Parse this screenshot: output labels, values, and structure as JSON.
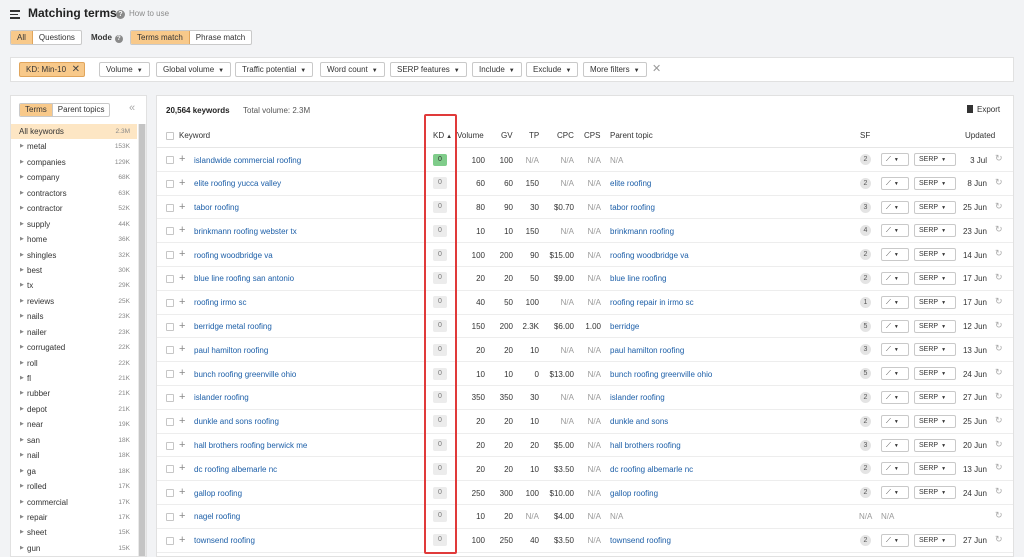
{
  "header": {
    "title": "Matching terms",
    "how_to_use": "How to use",
    "tabs": [
      "All",
      "Questions"
    ],
    "mode_label": "Mode",
    "modes": [
      "Terms match",
      "Phrase match"
    ]
  },
  "filters": {
    "active": "KD: Min-10",
    "buttons": [
      "Volume",
      "Global volume",
      "Traffic potential",
      "Word count",
      "SERP features",
      "Include",
      "Exclude",
      "More filters"
    ]
  },
  "sidebar": {
    "tabs": [
      "Terms",
      "Parent topics"
    ],
    "items": [
      {
        "label": "All keywords",
        "count": "2.3M"
      },
      {
        "label": "metal",
        "count": "153K"
      },
      {
        "label": "companies",
        "count": "129K"
      },
      {
        "label": "company",
        "count": "68K"
      },
      {
        "label": "contractors",
        "count": "63K"
      },
      {
        "label": "contractor",
        "count": "52K"
      },
      {
        "label": "supply",
        "count": "44K"
      },
      {
        "label": "home",
        "count": "36K"
      },
      {
        "label": "shingles",
        "count": "32K"
      },
      {
        "label": "best",
        "count": "30K"
      },
      {
        "label": "tx",
        "count": "29K"
      },
      {
        "label": "reviews",
        "count": "25K"
      },
      {
        "label": "nails",
        "count": "23K"
      },
      {
        "label": "nailer",
        "count": "23K"
      },
      {
        "label": "corrugated",
        "count": "22K"
      },
      {
        "label": "roll",
        "count": "22K"
      },
      {
        "label": "fl",
        "count": "21K"
      },
      {
        "label": "rubber",
        "count": "21K"
      },
      {
        "label": "depot",
        "count": "21K"
      },
      {
        "label": "near",
        "count": "19K"
      },
      {
        "label": "san",
        "count": "18K"
      },
      {
        "label": "nail",
        "count": "18K"
      },
      {
        "label": "ga",
        "count": "18K"
      },
      {
        "label": "rolled",
        "count": "17K"
      },
      {
        "label": "commercial",
        "count": "17K"
      },
      {
        "label": "repair",
        "count": "17K"
      },
      {
        "label": "sheet",
        "count": "15K"
      },
      {
        "label": "gun",
        "count": "15K"
      }
    ]
  },
  "main": {
    "keyword_count": "20,564 keywords",
    "total_volume": "Total volume: 2.3M",
    "export_label": "Export",
    "columns": {
      "keyword": "Keyword",
      "kd": "KD",
      "volume": "Volume",
      "gv": "GV",
      "tp": "TP",
      "cpc": "CPC",
      "cps": "CPS",
      "parent": "Parent topic",
      "sf": "SF",
      "updated": "Updated"
    },
    "serp_label": "SERP",
    "rows": [
      {
        "keyword": "islandwide commercial roofing",
        "kd": "0",
        "volume": "100",
        "gv": "100",
        "tp": "N/A",
        "cpc": "N/A",
        "cps": "N/A",
        "parent": "N/A",
        "sf": "2",
        "updated": "3 Jul"
      },
      {
        "keyword": "elite roofing yucca valley",
        "kd": "0",
        "volume": "60",
        "gv": "60",
        "tp": "150",
        "cpc": "N/A",
        "cps": "N/A",
        "parent": "elite roofing",
        "sf": "2",
        "updated": "8 Jun"
      },
      {
        "keyword": "tabor roofing",
        "kd": "0",
        "volume": "80",
        "gv": "90",
        "tp": "30",
        "cpc": "$0.70",
        "cps": "N/A",
        "parent": "tabor roofing",
        "sf": "3",
        "updated": "25 Jun"
      },
      {
        "keyword": "brinkmann roofing webster tx",
        "kd": "0",
        "volume": "10",
        "gv": "10",
        "tp": "150",
        "cpc": "N/A",
        "cps": "N/A",
        "parent": "brinkmann roofing",
        "sf": "4",
        "updated": "23 Jun"
      },
      {
        "keyword": "roofing woodbridge va",
        "kd": "0",
        "volume": "100",
        "gv": "200",
        "tp": "90",
        "cpc": "$15.00",
        "cps": "N/A",
        "parent": "roofing woodbridge va",
        "sf": "2",
        "updated": "14 Jun"
      },
      {
        "keyword": "blue line roofing san antonio",
        "kd": "0",
        "volume": "20",
        "gv": "20",
        "tp": "50",
        "cpc": "$9.00",
        "cps": "N/A",
        "parent": "blue line roofing",
        "sf": "2",
        "updated": "17 Jun"
      },
      {
        "keyword": "roofing irmo sc",
        "kd": "0",
        "volume": "40",
        "gv": "50",
        "tp": "100",
        "cpc": "N/A",
        "cps": "N/A",
        "parent": "roofing repair in irmo sc",
        "sf": "1",
        "updated": "17 Jun"
      },
      {
        "keyword": "berridge metal roofing",
        "kd": "0",
        "volume": "150",
        "gv": "200",
        "tp": "2.3K",
        "cpc": "$6.00",
        "cps": "1.00",
        "parent": "berridge",
        "sf": "5",
        "updated": "12 Jun"
      },
      {
        "keyword": "paul hamilton roofing",
        "kd": "0",
        "volume": "20",
        "gv": "20",
        "tp": "10",
        "cpc": "N/A",
        "cps": "N/A",
        "parent": "paul hamilton roofing",
        "sf": "3",
        "updated": "13 Jun"
      },
      {
        "keyword": "bunch roofing greenville ohio",
        "kd": "0",
        "volume": "10",
        "gv": "10",
        "tp": "0",
        "cpc": "$13.00",
        "cps": "N/A",
        "parent": "bunch roofing greenville ohio",
        "sf": "5",
        "updated": "24 Jun"
      },
      {
        "keyword": "islander roofing",
        "kd": "0",
        "volume": "350",
        "gv": "350",
        "tp": "30",
        "cpc": "N/A",
        "cps": "N/A",
        "parent": "islander roofing",
        "sf": "2",
        "updated": "27 Jun"
      },
      {
        "keyword": "dunkle and sons roofing",
        "kd": "0",
        "volume": "20",
        "gv": "20",
        "tp": "10",
        "cpc": "N/A",
        "cps": "N/A",
        "parent": "dunkle and sons",
        "sf": "2",
        "updated": "25 Jun"
      },
      {
        "keyword": "hall brothers roofing berwick me",
        "kd": "0",
        "volume": "20",
        "gv": "20",
        "tp": "20",
        "cpc": "$5.00",
        "cps": "N/A",
        "parent": "hall brothers roofing",
        "sf": "3",
        "updated": "20 Jun"
      },
      {
        "keyword": "dc roofing albemarle nc",
        "kd": "0",
        "volume": "20",
        "gv": "20",
        "tp": "10",
        "cpc": "$3.50",
        "cps": "N/A",
        "parent": "dc roofing albemarle nc",
        "sf": "2",
        "updated": "13 Jun"
      },
      {
        "keyword": "gallop roofing",
        "kd": "0",
        "volume": "250",
        "gv": "300",
        "tp": "100",
        "cpc": "$10.00",
        "cps": "N/A",
        "parent": "gallop roofing",
        "sf": "2",
        "updated": "24 Jun"
      },
      {
        "keyword": "nagel roofing",
        "kd": "0",
        "volume": "10",
        "gv": "20",
        "tp": "N/A",
        "cpc": "$4.00",
        "cps": "N/A",
        "parent": "N/A",
        "sf": "N/A",
        "trend": "N/A",
        "updated": ""
      },
      {
        "keyword": "townsend roofing",
        "kd": "0",
        "volume": "100",
        "gv": "250",
        "tp": "40",
        "cpc": "$3.50",
        "cps": "N/A",
        "parent": "townsend roofing",
        "sf": "2",
        "updated": "27 Jun"
      }
    ]
  },
  "colors": {
    "accent": "#f8c98a",
    "link": "#1d5fa8",
    "kd_easy": "#7fcc8a",
    "highlight_box": "#e03a3a"
  }
}
